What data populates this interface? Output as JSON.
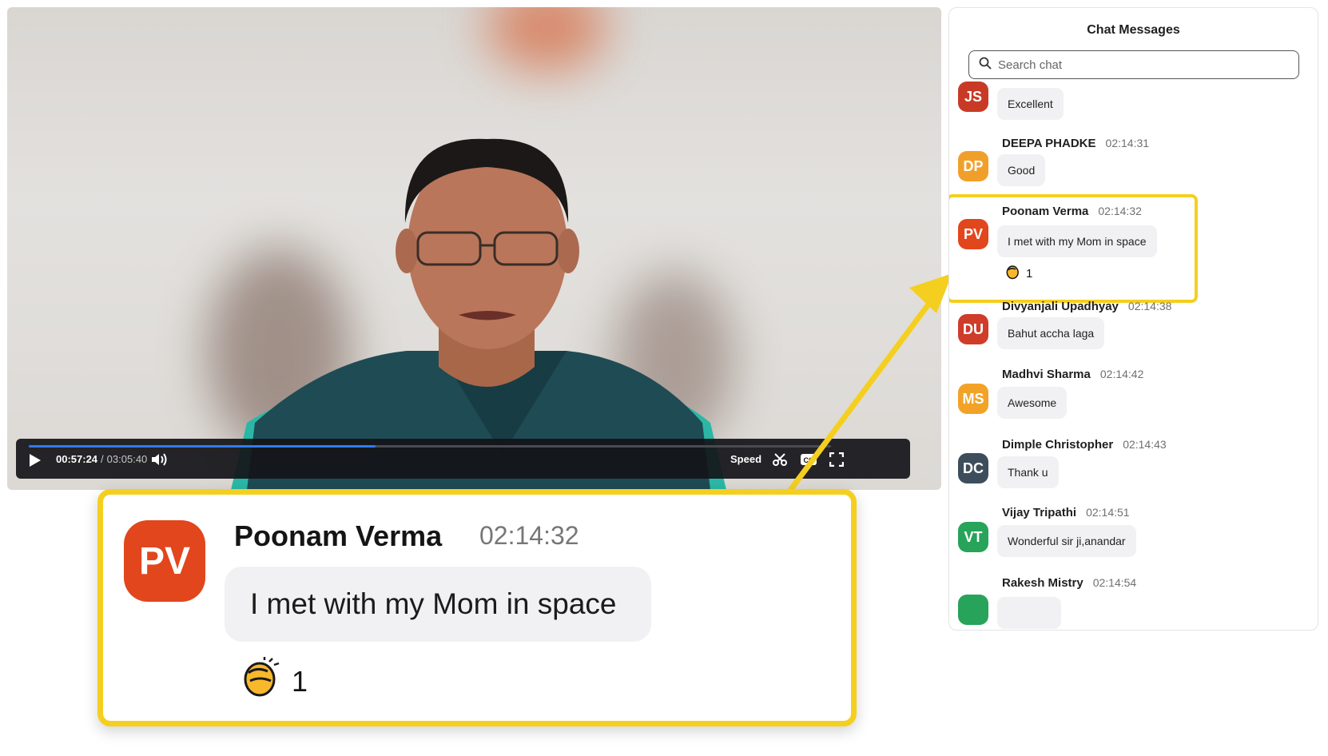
{
  "player": {
    "current_time": "00:57:24",
    "separator": "/",
    "total_time": "03:05:40",
    "speed_label": "Speed",
    "progress": 0.4318,
    "accent_color": "#2f7cf6"
  },
  "callout": {
    "avatar_initials": "PV",
    "name": "Poonam Verma",
    "time": "02:14:32",
    "message": "I met with my Mom in space",
    "reaction_icon": "clapping-hands-icon",
    "reaction_count": "1",
    "highlight_color": "#f5cf1f"
  },
  "chat": {
    "title": "Chat Messages",
    "search_placeholder": "Search chat",
    "messages": [
      {
        "initials": "JS",
        "name": "",
        "time": "",
        "text": "Excellent",
        "color": "#c83a26"
      },
      {
        "initials": "DP",
        "name": "DEEPA PHADKE",
        "time": "02:14:31",
        "text": "Good",
        "color": "#f0a02a"
      },
      {
        "initials": "PV",
        "name": "Poonam Verma",
        "time": "02:14:32",
        "text": "I met with my Mom in space",
        "color": "#e2461c",
        "reaction_icon": "clapping-hands-icon",
        "reaction_count": "1"
      },
      {
        "initials": "DU",
        "name": "Divyanjali Upadhyay",
        "time": "02:14:38",
        "text": "Bahut accha laga",
        "color": "#cf3c2a"
      },
      {
        "initials": "MS",
        "name": "Madhvi Sharma",
        "time": "02:14:42",
        "text": "Awesome",
        "color": "#f2a327"
      },
      {
        "initials": "DC",
        "name": "Dimple Christopher",
        "time": "02:14:43",
        "text": "Thank u",
        "color": "#3d4d5c"
      },
      {
        "initials": "VT",
        "name": "Vijay Tripathi",
        "time": "02:14:51",
        "text": "Wonderful sir ji,anandar",
        "color": "#27a35a"
      },
      {
        "initials": "",
        "name": "Rakesh Mistry",
        "time": "02:14:54",
        "text": "",
        "color": "#27a35a"
      }
    ]
  }
}
